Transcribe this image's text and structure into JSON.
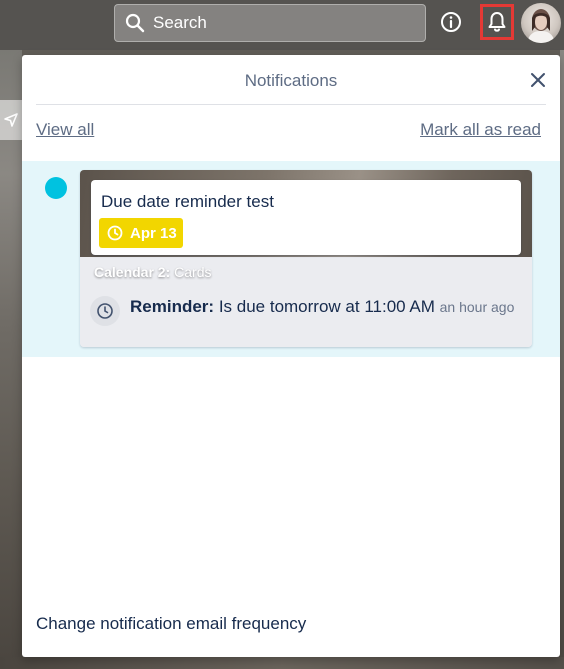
{
  "topbar": {
    "search_placeholder": "Search",
    "icons": {
      "search": "search-icon",
      "info": "info-icon",
      "bell": "bell-icon"
    }
  },
  "panel": {
    "title": "Notifications",
    "view_all": "View all",
    "mark_all_read": "Mark all as read",
    "email_frequency": "Change notification email frequency"
  },
  "notification": {
    "card_title": "Due date reminder test",
    "due_date": "Apr 13",
    "board_name": "Calendar 2:",
    "list_name": "Cards",
    "reminder_label": "Reminder:",
    "reminder_text": "Is due tomorrow at 11:00 AM",
    "time_ago": "an hour ago",
    "unread_color": "#00c2e0",
    "due_color": "#f2d600"
  },
  "colors": {
    "alert_highlight": "#e53935"
  }
}
